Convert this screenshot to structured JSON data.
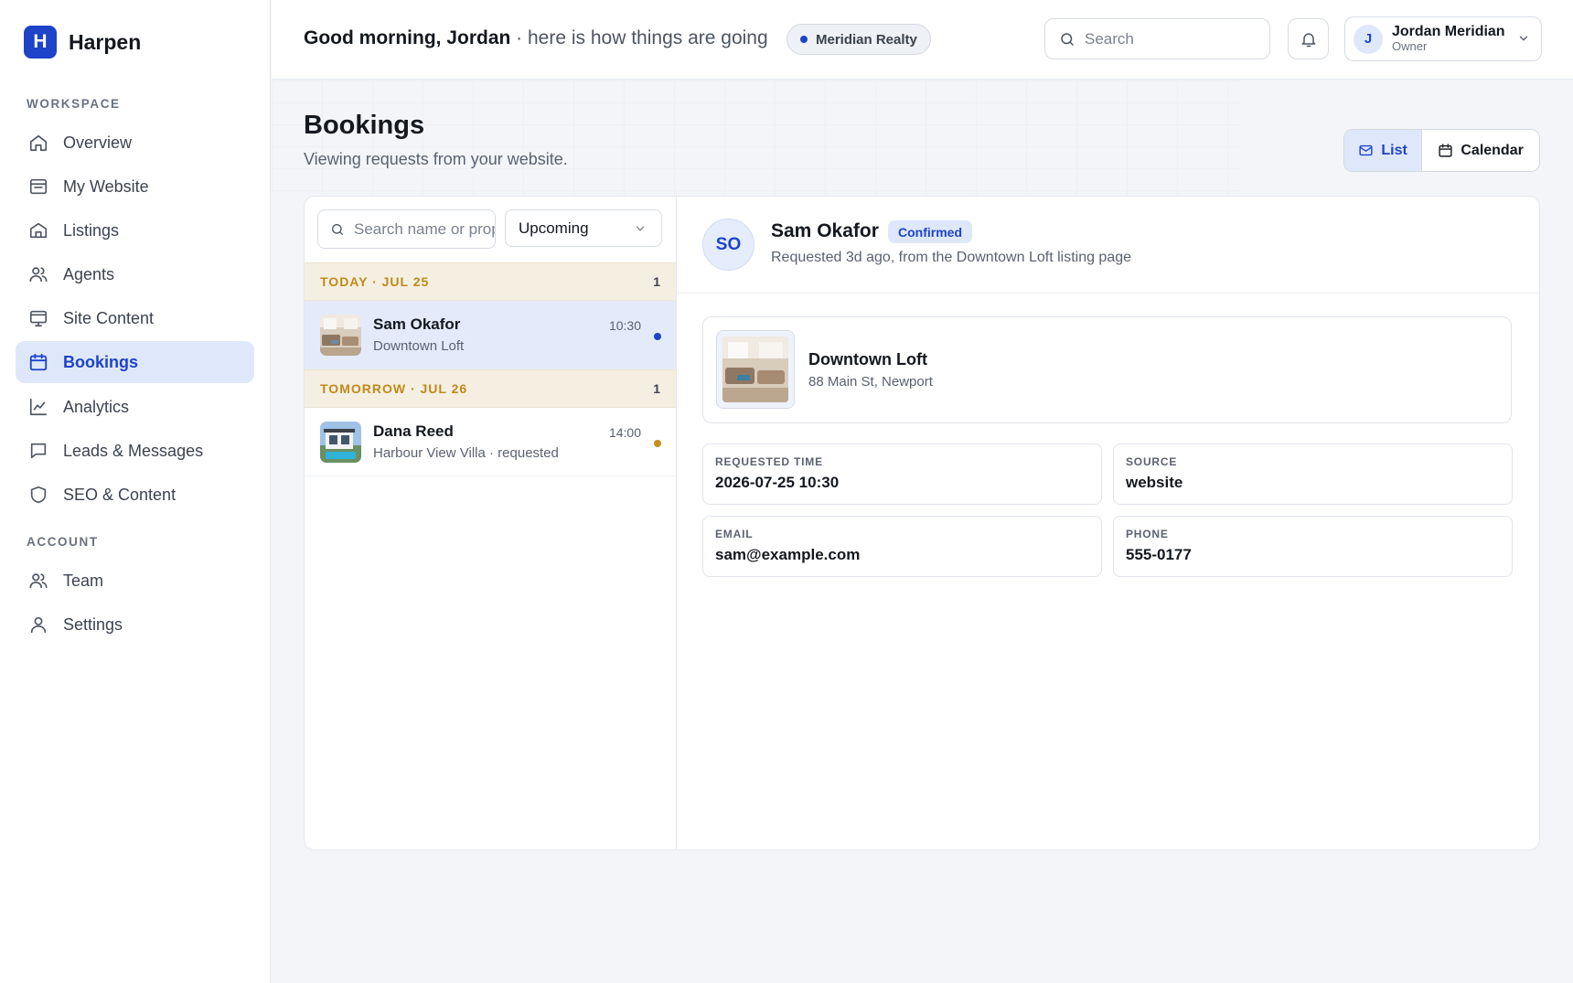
{
  "brand": {
    "logo_letter": "H",
    "name": "Harpen",
    "accent": "#1d43c9"
  },
  "sidebar": {
    "workspace_label": "WORKSPACE",
    "account_label": "ACCOUNT",
    "workspace_items": [
      {
        "label": "Overview",
        "icon": "home-icon"
      },
      {
        "label": "My Website",
        "icon": "browser-icon"
      },
      {
        "label": "Listings",
        "icon": "house-icon"
      },
      {
        "label": "Agents",
        "icon": "users-icon"
      },
      {
        "label": "Site Content",
        "icon": "monitor-icon"
      },
      {
        "label": "Bookings",
        "icon": "calendar-icon",
        "active": true
      },
      {
        "label": "Analytics",
        "icon": "chart-icon"
      },
      {
        "label": "Leads & Messages",
        "icon": "message-icon"
      },
      {
        "label": "SEO & Content",
        "icon": "shield-icon"
      }
    ],
    "account_items": [
      {
        "label": "Team",
        "icon": "users-icon"
      },
      {
        "label": "Settings",
        "icon": "user-icon"
      }
    ]
  },
  "header": {
    "greeting_name": "Good morning, Jordan",
    "greeting_rest": " · here is how things are going",
    "org": "Meridian Realty",
    "search_placeholder": "Search",
    "user": {
      "initial": "J",
      "name": "Jordan Meridian",
      "role": "Owner"
    }
  },
  "page": {
    "title": "Bookings",
    "subtitle": "Viewing requests from your website.",
    "views": {
      "list": "List",
      "calendar": "Calendar",
      "selected": "List"
    }
  },
  "list": {
    "search_placeholder": "Search name or property",
    "filter": "Upcoming",
    "groups": [
      {
        "label": "TODAY · JUL 25",
        "count": "1",
        "items": [
          {
            "name": "Sam Okafor",
            "property": "Downtown Loft",
            "time": "10:30",
            "dot_color": "#1d43c9",
            "selected": true
          }
        ]
      },
      {
        "label": "TOMORROW · JUL 26",
        "count": "1",
        "items": [
          {
            "name": "Dana Reed",
            "property": "Harbour View Villa · requested",
            "time": "14:00",
            "dot_color": "#c98f1b",
            "selected": false
          }
        ]
      }
    ]
  },
  "detail": {
    "initials": "SO",
    "name": "Sam Okafor",
    "status": "Confirmed",
    "subtitle": "Requested 3d ago, from the Downtown Loft listing page",
    "property": {
      "name": "Downtown Loft",
      "address": "88 Main St, Newport"
    },
    "fields": [
      {
        "label": "REQUESTED TIME",
        "value": "2026-07-25 10:30"
      },
      {
        "label": "SOURCE",
        "value": "website"
      },
      {
        "label": "EMAIL",
        "value": "sam@example.com"
      },
      {
        "label": "PHONE",
        "value": "555-0177"
      }
    ]
  }
}
